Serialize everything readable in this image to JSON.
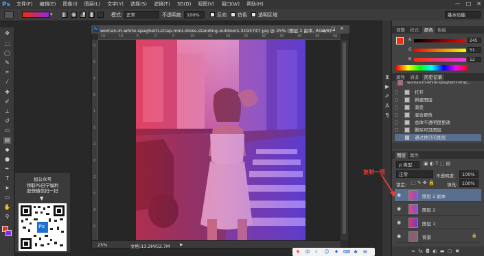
{
  "menubar": {
    "logo": "Ps",
    "items": [
      "文件(F)",
      "编辑(E)",
      "图像(I)",
      "图层(L)",
      "文字(Y)",
      "选择(S)",
      "滤镜(T)",
      "3D(D)",
      "视图(V)",
      "窗口(W)",
      "帮助(H)"
    ],
    "window_controls": [
      "—",
      "□",
      "✕"
    ]
  },
  "options_bar": {
    "mode_label": "模式:",
    "mode_value": "正常",
    "opacity_label": "不透明度:",
    "opacity_value": "100%",
    "reverse_label": "反向",
    "dither_label": "仿色",
    "transparency_label": "透明区域",
    "workspace_value": "基本功能"
  },
  "document": {
    "tab_title": "woman-in-white-spaghetti-strap-mini-dress-standing-outdoors-3193747.jpg @ 25% (图层 2 副本, RGB/8) *",
    "zoom": "25%",
    "doc_info": "文档:13.2M/52.7M",
    "ruler_top": [
      "15",
      "10",
      "5",
      "0",
      "5",
      "10",
      "15",
      "20",
      "25",
      "30",
      "35",
      "40",
      "45",
      "50"
    ],
    "ruler_left": [
      "0",
      "5",
      "1",
      "0",
      "1",
      "5",
      "2",
      "0",
      "2",
      "5",
      "3",
      "0"
    ]
  },
  "promo": {
    "line1": "加公众号",
    "line2": "领取PS自学福利",
    "line3": "赶快微信扫一扫"
  },
  "panels": {
    "color_tabs": [
      "调整",
      "样式",
      "颜色",
      "色板"
    ],
    "color_active": "颜色",
    "r_label": "R",
    "g_label": "G",
    "b_label": "B",
    "r_value": "245",
    "g_value": "51",
    "b_value": "12",
    "history_tabs": [
      "属性",
      "通道",
      "历史记录"
    ],
    "history_active": "历史记录",
    "history_snapshot": "woman-in-white-spaghetti-strap...",
    "history_items": [
      "打开",
      "新建图层",
      "渐变",
      "混合更改",
      "总体不透明度更改",
      "删除可见图层",
      "通过拷贝的图层"
    ],
    "layers_tabs": [
      "图层",
      "属性"
    ],
    "layers_active": "图层",
    "kind_label": "ρ 类型",
    "blend_mode": "正常",
    "opacity_label": "不透明度:",
    "opacity_value": "100%",
    "lock_label": "锁定:",
    "fill_label": "填充:",
    "fill_value": "100%",
    "layers": [
      "图层 2 副本",
      "图层 2",
      "图层 1",
      "背景"
    ],
    "background_lock": "🔒"
  },
  "annotation": {
    "text": "复制一层",
    "color": "#e03c3c"
  },
  "colors": {
    "foreground": "#f52d0c",
    "background": "#8a2be2",
    "accent": "#3fa2ff"
  }
}
